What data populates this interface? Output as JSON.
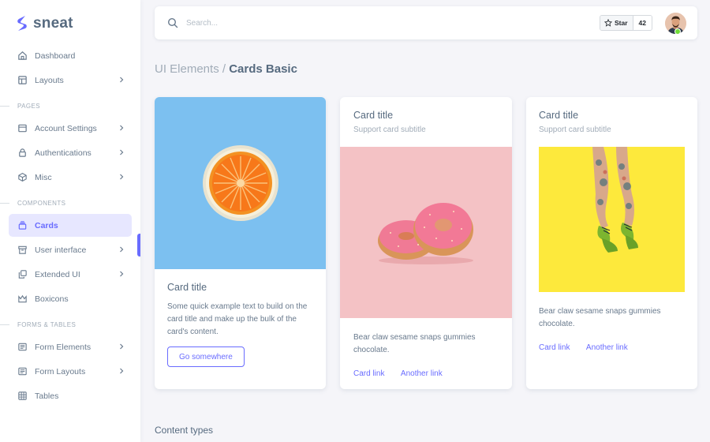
{
  "brand": {
    "name": "sneat",
    "accent": "#696cff"
  },
  "sidebar": {
    "items": [
      {
        "label": "Dashboard",
        "icon": "home-icon",
        "chevron": false
      },
      {
        "label": "Layouts",
        "icon": "layout-icon",
        "chevron": true
      }
    ],
    "pages_header": "PAGES",
    "pages": [
      {
        "label": "Account Settings",
        "icon": "dock-icon",
        "chevron": true
      },
      {
        "label": "Authentications",
        "icon": "lock-icon",
        "chevron": true
      },
      {
        "label": "Misc",
        "icon": "cube-icon",
        "chevron": true
      }
    ],
    "components_header": "COMPONENTS",
    "components": [
      {
        "label": "Cards",
        "icon": "collection-icon",
        "chevron": false,
        "active": true
      },
      {
        "label": "User interface",
        "icon": "box-icon",
        "chevron": true
      },
      {
        "label": "Extended UI",
        "icon": "copy-icon",
        "chevron": true
      },
      {
        "label": "Boxicons",
        "icon": "crown-icon",
        "chevron": false
      }
    ],
    "forms_header": "FORMS & TABLES",
    "forms": [
      {
        "label": "Form Elements",
        "icon": "detail-icon",
        "chevron": true
      },
      {
        "label": "Form Layouts",
        "icon": "detail-icon",
        "chevron": true
      },
      {
        "label": "Tables",
        "icon": "table-icon",
        "chevron": false
      }
    ]
  },
  "navbar": {
    "search_placeholder": "Search...",
    "github_star_label": "Star",
    "github_star_count": "42"
  },
  "breadcrumb": {
    "parent": "UI Elements",
    "separator": "/",
    "current": "Cards Basic"
  },
  "cards": [
    {
      "image": "orange-slice",
      "image_bg": "#7cc0f0",
      "title": "Card title",
      "text": "Some quick example text to build on the card title and make up the bulk of the card's content.",
      "button": "Go somewhere"
    },
    {
      "title": "Card title",
      "subtitle": "Support card subtitle",
      "image": "donuts",
      "image_bg": "#f4c2c5",
      "text": "Bear claw sesame snaps gummies chocolate.",
      "links": [
        "Card link",
        "Another link"
      ]
    },
    {
      "title": "Card title",
      "subtitle": "Support card subtitle",
      "image": "sneakers-legs",
      "image_bg": "#fde93c",
      "text": "Bear claw sesame snaps gummies chocolate.",
      "links": [
        "Card link",
        "Another link"
      ]
    }
  ],
  "section_title": "Content types"
}
